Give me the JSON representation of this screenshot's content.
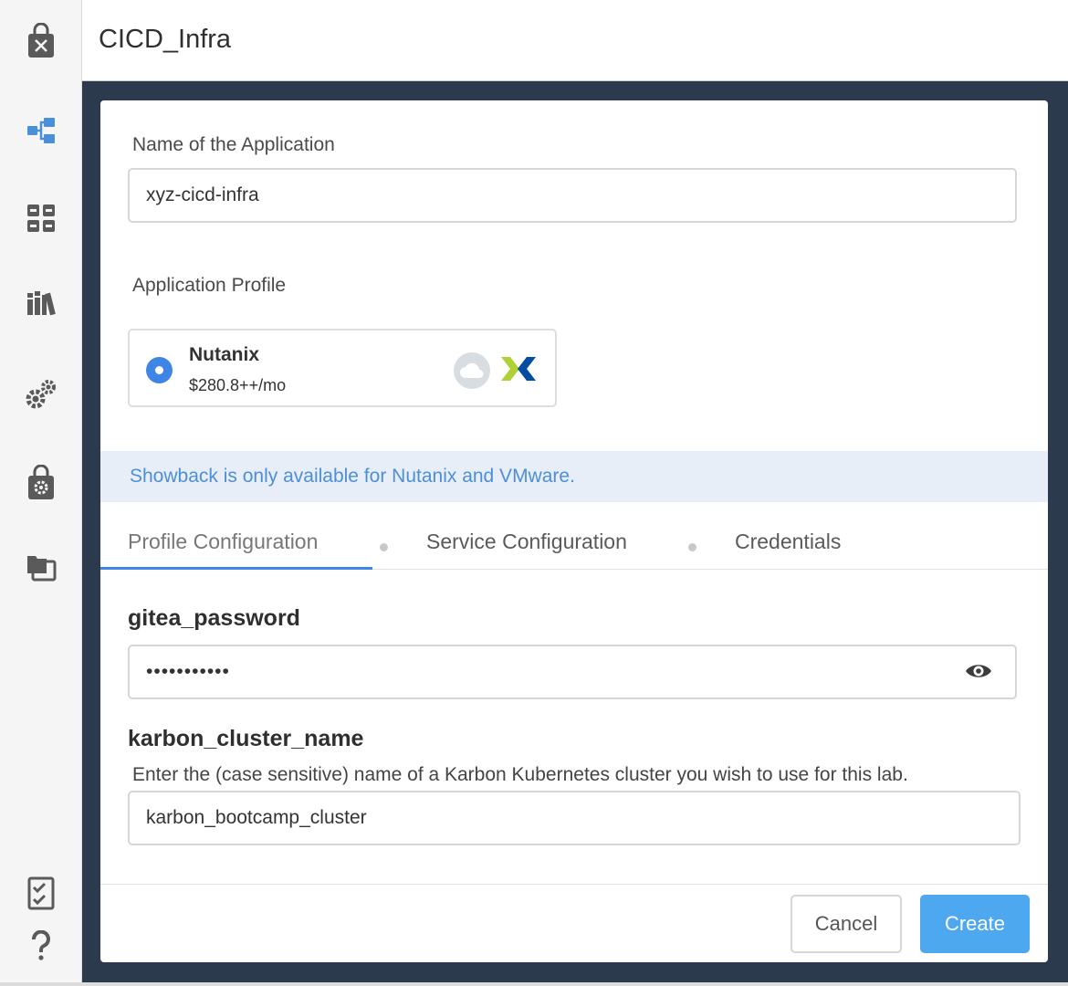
{
  "header": {
    "title": "CICD_Infra"
  },
  "sidebar": {
    "items": [
      {
        "icon": "marketplace-bag-icon"
      },
      {
        "icon": "blueprint-icon"
      },
      {
        "icon": "applications-grid-icon"
      },
      {
        "icon": "library-icon"
      },
      {
        "icon": "settings-gears-icon"
      },
      {
        "icon": "marketplace-manager-icon"
      },
      {
        "icon": "projects-icon"
      },
      {
        "icon": "tasks-checklist-icon"
      },
      {
        "icon": "help-icon"
      }
    ]
  },
  "form": {
    "app_name_label": "Name of the Application",
    "app_name_value": "xyz-cicd-infra",
    "profile_label": "Application Profile",
    "profile": {
      "name": "Nutanix",
      "price": "$280.8++/mo",
      "selected": true
    },
    "notice": "Showback is only available for Nutanix and VMware.",
    "tabs": [
      {
        "label": "Profile Configuration",
        "active": true
      },
      {
        "label": "Service Configuration",
        "active": false
      },
      {
        "label": "Credentials",
        "active": false
      }
    ],
    "gitea_password": {
      "title": "gitea_password",
      "value": "•••••••••••"
    },
    "karbon_cluster_name": {
      "title": "karbon_cluster_name",
      "help": "Enter the (case sensitive) name of a Karbon Kubernetes cluster you wish to use for this lab.",
      "value": "karbon_bootcamp_cluster"
    }
  },
  "actions": {
    "cancel_label": "Cancel",
    "create_label": "Create"
  },
  "colors": {
    "accent": "#3e85e6",
    "primary_button": "#4ea8f0",
    "backdrop": "#2c3a4d",
    "notice_bg": "#e8eef8",
    "nutanix_green": "#afd136",
    "nutanix_navy": "#024da1"
  }
}
